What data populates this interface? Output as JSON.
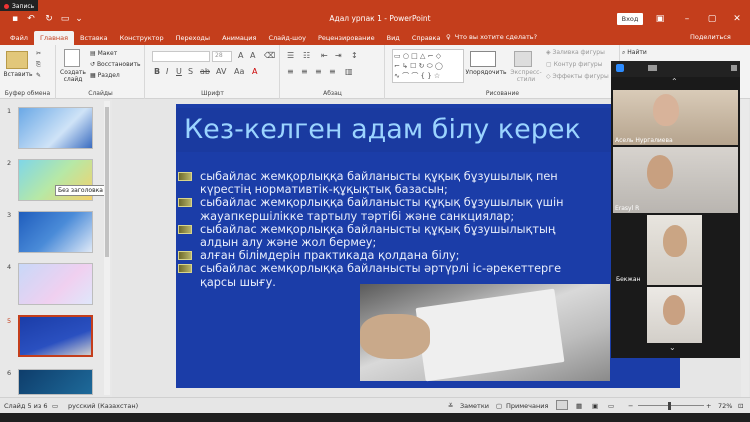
{
  "recording": {
    "label": "Запись"
  },
  "window": {
    "title": "Адал урпак 1 - PowerPoint",
    "signin": "Вход"
  },
  "tabs": [
    {
      "label": "Файл"
    },
    {
      "label": "Главная"
    },
    {
      "label": "Вставка"
    },
    {
      "label": "Конструктор"
    },
    {
      "label": "Переходы"
    },
    {
      "label": "Анимация"
    },
    {
      "label": "Слайд-шоу"
    },
    {
      "label": "Рецензирование"
    },
    {
      "label": "Вид"
    },
    {
      "label": "Справка"
    }
  ],
  "tellme": "Что вы хотите сделать?",
  "share": "Поделиться",
  "ribbon": {
    "paste": "Вставить",
    "clipboard": "Буфер обмена",
    "new_slide": "Создать слайд",
    "layout": "Макет",
    "reset": "Восстановить",
    "section": "Раздел",
    "slides": "Слайды",
    "font_size": "28",
    "font": "Шрифт",
    "paragraph": "Абзац",
    "arrange": "Упорядочить",
    "express": "Экспресс-стили",
    "fill": "Заливка фигуры",
    "outline": "Контур фигуры",
    "effects": "Эффекты фигуры",
    "find": "Найти",
    "drawing": "Рисование"
  },
  "tooltip": "Без заголовка",
  "thumbnails": [
    {
      "num": "1"
    },
    {
      "num": "2"
    },
    {
      "num": "3"
    },
    {
      "num": "4"
    },
    {
      "num": "5"
    },
    {
      "num": "6"
    }
  ],
  "slide": {
    "title": "Кез-келген адам  білу керек",
    "bullets": [
      "сыбайлас жемқорлыққа байланысты құқық бұзушылық пен",
      "күрестің нормативтік-құқықтық базасын;",
      "сыбайлас жемқорлыққа байланысты құқық бұзушылық үшін",
      "жауапкершілікке тартылу тәртібі және санкциялар;",
      "сыбайлас жемқорлыққа байланысты құқық бұзушылықтың",
      "алдын алу және жол бермеу;",
      "алған білімдерін практикада қолдана білу;",
      "сыбайлас жемқорлыққа байланысты әртүрлі іс-әрекеттерге",
      "қарсы шығу."
    ]
  },
  "participants": [
    {
      "name": "Асель Нургалиева"
    },
    {
      "name": "Erasyl R"
    },
    {
      "name": "Бекжан"
    },
    {
      "name": ""
    }
  ],
  "status": {
    "slide": "Слайд 5 из 6",
    "lang": "русский (Казахстан)",
    "notes": "Заметки",
    "comments": "Примечания",
    "zoom": "72%"
  }
}
